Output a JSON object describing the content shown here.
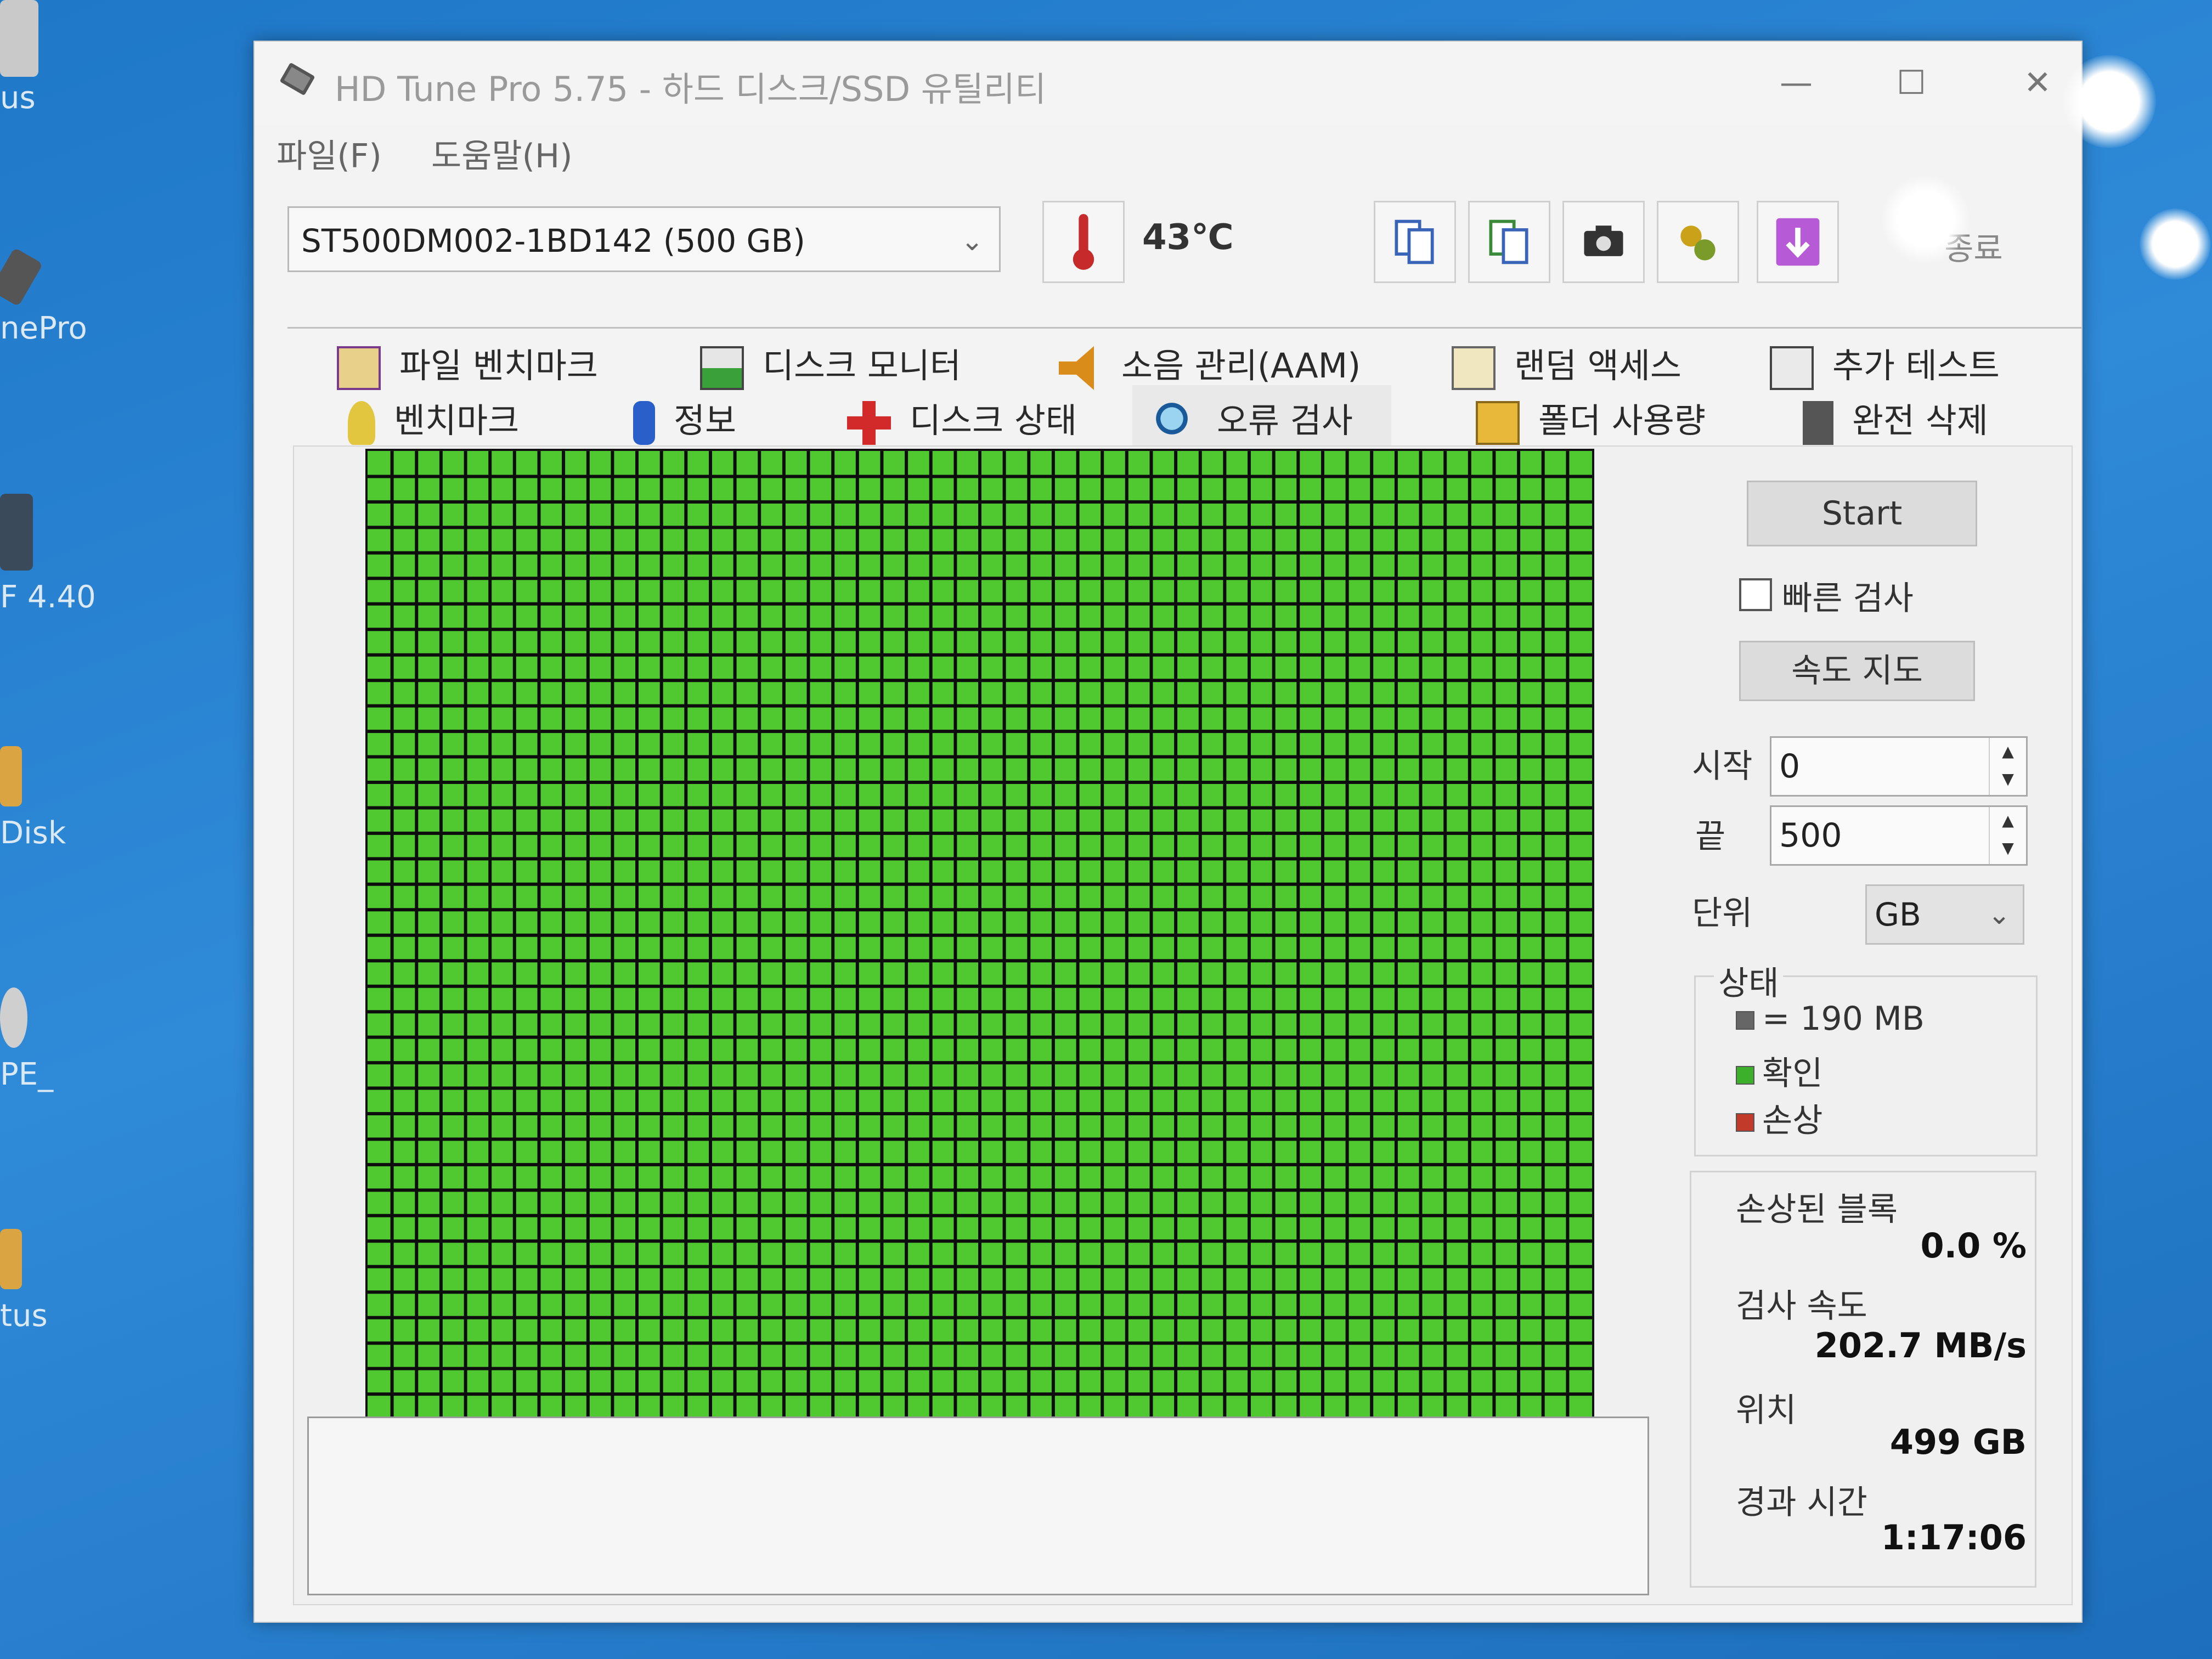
{
  "desktop": {
    "icons": [
      "us",
      "nePro",
      "F 4.40",
      "Disk",
      "PE_",
      "tus"
    ]
  },
  "window": {
    "title": "HD Tune Pro 5.75 - 하드 디스크/SSD 유틸리티",
    "menu": [
      "파일(F)",
      "도움말(H)"
    ]
  },
  "toolbar": {
    "drive": "ST500DM002-1BD142 (500 GB)",
    "temperature": "43℃",
    "exit_label": "종료"
  },
  "tabs": {
    "row1": [
      "파일 벤치마크",
      "디스크 모니터",
      "소음 관리(AAM)",
      "랜덤 액세스",
      "추가 테스트"
    ],
    "row2": [
      "벤치마크",
      "정보",
      "디스크 상태",
      "오류 검사",
      "폴더 사용량",
      "완전 삭제"
    ],
    "active": "오류 검사"
  },
  "scan": {
    "grid_cols": 50,
    "grid_rows": 39,
    "ok_color": "#4fc92f",
    "grid_line_color": "#0d0d0d"
  },
  "controls": {
    "start_label": "Start",
    "quick_scan_label": "빠른 검사",
    "quick_scan_checked": false,
    "speed_map_label": "속도 지도",
    "start_field_label": "시작",
    "start_value": "0",
    "end_field_label": "끝",
    "end_value": "500",
    "unit_label": "단위",
    "unit_value": "GB"
  },
  "legend": {
    "title": "상태",
    "block_size": "= 190 MB",
    "ok_label": "확인",
    "damaged_label": "손상",
    "colors": {
      "block": "#666666",
      "ok": "#3cb02a",
      "damaged": "#c23a2a"
    }
  },
  "stats": {
    "damaged_blocks_label": "손상된 블록",
    "damaged_blocks_value": "0.0 %",
    "scan_speed_label": "검사 속도",
    "scan_speed_value": "202.7 MB/s",
    "position_label": "위치",
    "position_value": "499 GB",
    "elapsed_label": "경과 시간",
    "elapsed_value": "1:17:06"
  }
}
